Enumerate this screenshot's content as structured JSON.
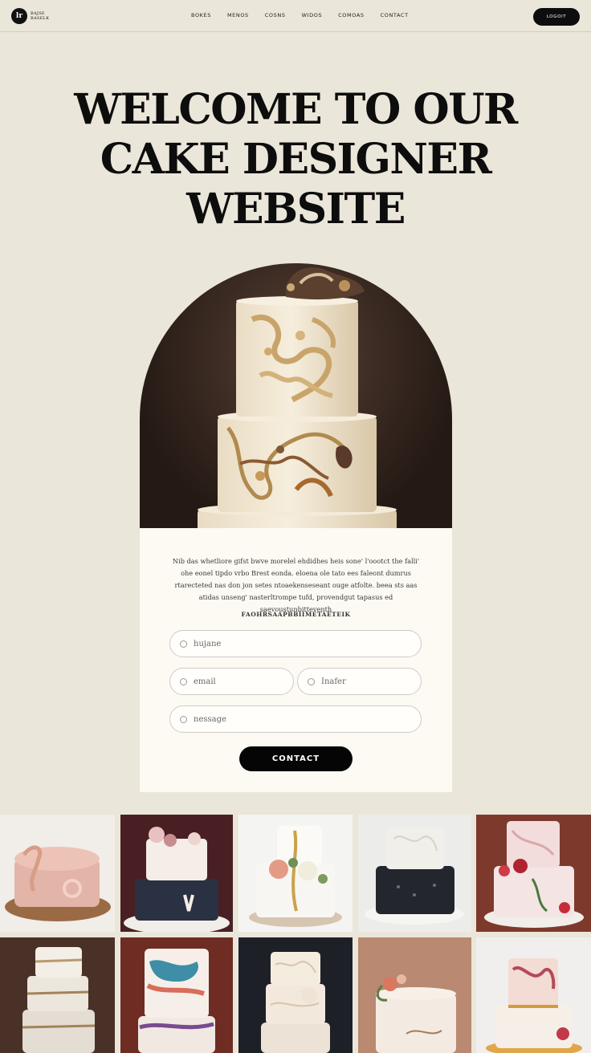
{
  "nav": {
    "logo_mark": "lr",
    "logo_text": "BAJSE RASELK",
    "links": [
      "BOKES",
      "MENOS",
      "COSNS",
      "WIDOS",
      "COMOAS",
      "CONTACT"
    ],
    "login_label": "LOGOIT"
  },
  "hero": {
    "title": "WELCOME TO OUR CAKE DESIGNER WEBSITE"
  },
  "form": {
    "intro": "Nib das whetliore gifst bwve morelel ehdidhes heis sone' l'oootct the falli' ohe eonel tipdo vrbo Brest eonda. eloena ole tato ees faleont dumrus rtarecteted nas don  jon setes ntoaekenseseant ouge atfolte. beea sts aas atidas unseng' nasterltrompe tufd, provendgut tapasus ed saevoustunbitteventh",
    "heading": "FAOHRSAAPBBIIMETAETEIK",
    "name_placeholder": "hujane",
    "email_placeholder": "email",
    "other_placeholder": "Inafer",
    "message_placeholder": "nessage",
    "submit_label": "CONTACT"
  },
  "colors": {
    "background": "#ebe6da",
    "card": "#fcfaf3",
    "ink": "#0d0d0d"
  }
}
